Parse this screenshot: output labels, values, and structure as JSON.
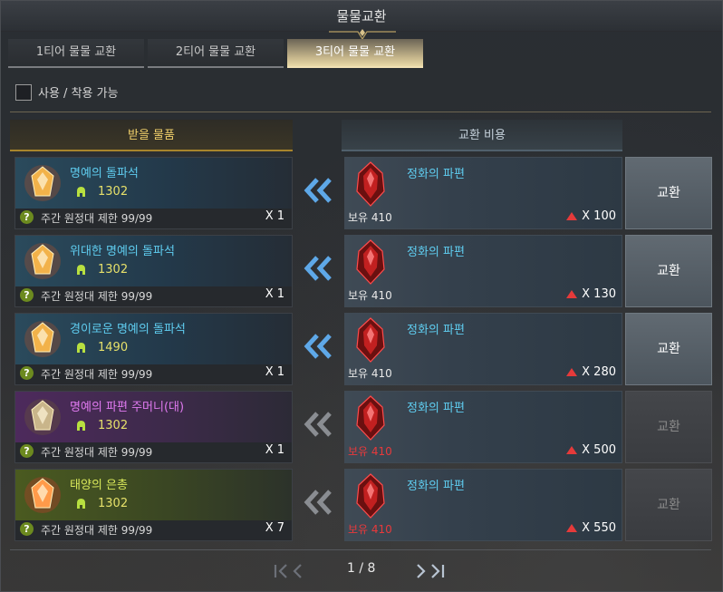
{
  "window": {
    "title": "물물교환"
  },
  "tabs": [
    {
      "label": "1티어 물물 교환",
      "active": false
    },
    {
      "label": "2티어 물물 교환",
      "active": false
    },
    {
      "label": "3티어 물물 교환",
      "active": true
    }
  ],
  "filter": {
    "label": "사용 / 착용 가능",
    "checked": false
  },
  "columns": {
    "reward": "받을 물품",
    "cost": "교환 비용"
  },
  "rows": [
    {
      "name": "명예의 돌파석",
      "name_color": "#5fcdf0",
      "level": "1302",
      "limit": "주간 원정대 제한 99/99",
      "qty": "X 1",
      "cost_name": "정화의 파편",
      "owned": "보유 410",
      "owned_sufficient": true,
      "cost_qty": "X 100",
      "button": "교환",
      "enabled": true,
      "rarity": "blue"
    },
    {
      "name": "위대한 명예의 돌파석",
      "name_color": "#5fcdf0",
      "level": "1302",
      "limit": "주간 원정대 제한 99/99",
      "qty": "X 1",
      "cost_name": "정화의 파편",
      "owned": "보유 410",
      "owned_sufficient": true,
      "cost_qty": "X 130",
      "button": "교환",
      "enabled": true,
      "rarity": "blue"
    },
    {
      "name": "경이로운 명예의 돌파석",
      "name_color": "#5fcdf0",
      "level": "1490",
      "limit": "주간 원정대 제한 99/99",
      "qty": "X 1",
      "cost_name": "정화의 파편",
      "owned": "보유 410",
      "owned_sufficient": true,
      "cost_qty": "X 280",
      "button": "교환",
      "enabled": true,
      "rarity": "blue"
    },
    {
      "name": "명예의 파편 주머니(대)",
      "name_color": "#e07af0",
      "level": "1302",
      "limit": "주간 원정대 제한 99/99",
      "qty": "X 1",
      "cost_name": "정화의 파편",
      "owned": "보유 410",
      "owned_sufficient": false,
      "cost_qty": "X 500",
      "button": "교환",
      "enabled": false,
      "rarity": "purple"
    },
    {
      "name": "태양의 은총",
      "name_color": "#d9e85a",
      "level": "1302",
      "limit": "주간 원정대 제한 99/99",
      "qty": "X 7",
      "cost_name": "정화의 파편",
      "owned": "보유 410",
      "owned_sufficient": false,
      "cost_qty": "X 550",
      "button": "교환",
      "enabled": false,
      "rarity": "green"
    }
  ],
  "pagination": {
    "text": "1 / 8"
  },
  "colors": {
    "accent_gold": "#f0cf6a",
    "cost_text": "#5fcdf0",
    "insufficient": "#e8393b"
  }
}
